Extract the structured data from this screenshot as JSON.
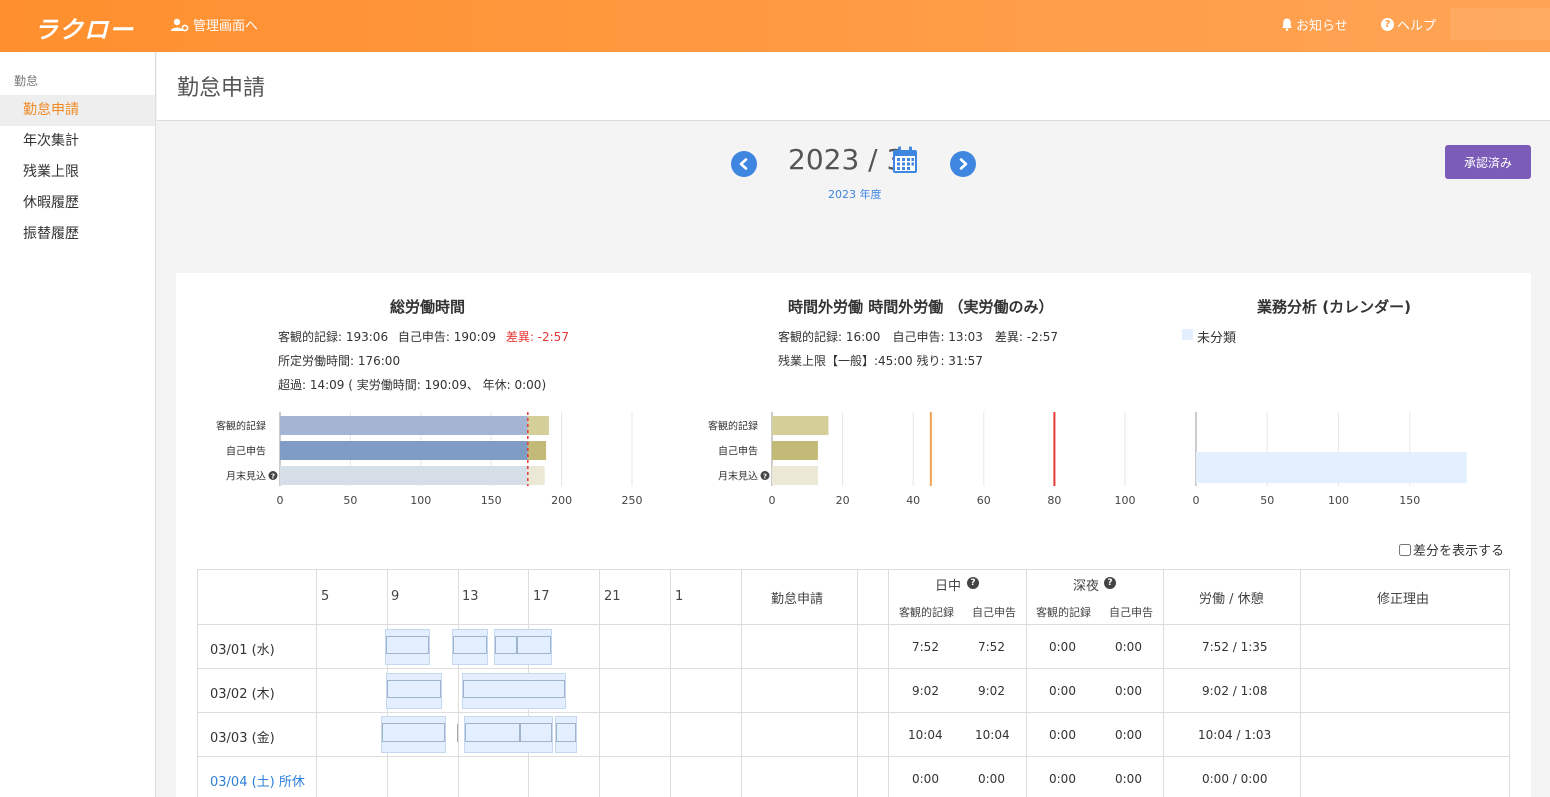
{
  "header": {
    "logo": "ラクロー",
    "admin_link": "管理画面へ",
    "notice": "お知らせ",
    "help": "ヘルプ"
  },
  "sidebar": {
    "section": "勤怠",
    "items": [
      {
        "label": "勤怠申請",
        "active": true
      },
      {
        "label": "年次集計"
      },
      {
        "label": "残業上限"
      },
      {
        "label": "休暇履歴"
      },
      {
        "label": "振替履歴"
      }
    ]
  },
  "page": {
    "title": "勤怠申請",
    "month_label": "2023 / 3",
    "fiscal_year": "2023 年度",
    "approved_button": "承認済み"
  },
  "summary": {
    "total": {
      "title": "総労働時間",
      "line1_objective": "客観的記録: 193:06",
      "line1_self": "自己申告: 190:09",
      "line1_diff": "差異: -2:57",
      "line2": "所定労働時間: 176:00",
      "line3": "超過: 14:09 ( 実労働時間: 190:09、 年休: 0:00)"
    },
    "overtime": {
      "title": "時間外労働 時間外労働 （実労働のみ）",
      "line1": "客観的記録: 16:00　自己申告: 13:03　差異: -2:57",
      "line2": "残業上限【一般】:45:00  残り: 31:57"
    },
    "analysis": {
      "title": "業務分析 (カレンダー)",
      "legend": "未分類"
    }
  },
  "chart_data": [
    {
      "type": "bar",
      "orientation": "horizontal",
      "stacked": true,
      "categories": [
        "客観的記録",
        "自己申告",
        "月末見込"
      ],
      "series": [
        {
          "values": [
            176,
            176,
            176
          ],
          "colors": [
            "#a4b5d3",
            "#7f9cc4",
            "#d6dee8"
          ]
        },
        {
          "values": [
            15,
            13,
            12
          ],
          "colors": [
            "#d4cf98",
            "#c2ba76",
            "#ece8d6"
          ]
        }
      ],
      "xlim": [
        0,
        250
      ],
      "xticks": [
        0,
        50,
        100,
        150,
        200,
        250
      ],
      "reference_lines": [
        {
          "x": 176,
          "color": "#e53935",
          "style": "dashed"
        }
      ]
    },
    {
      "type": "bar",
      "orientation": "horizontal",
      "categories": [
        "客観的記録",
        "自己申告",
        "月末見込"
      ],
      "values": [
        16,
        13,
        13
      ],
      "colors": [
        "#d4cf98",
        "#c2ba76",
        "#ece8d6"
      ],
      "xlim": [
        0,
        100
      ],
      "xticks": [
        0,
        20,
        40,
        60,
        80,
        100
      ],
      "reference_lines": [
        {
          "x": 45,
          "color": "#f0a050"
        },
        {
          "x": 80,
          "color": "#e53935"
        }
      ]
    },
    {
      "type": "bar",
      "orientation": "horizontal",
      "categories": [
        "未分類"
      ],
      "values": [
        190
      ],
      "colors": [
        "#e3efff"
      ],
      "xlim": [
        0,
        200
      ],
      "xticks": [
        0,
        50,
        100,
        150
      ]
    }
  ],
  "icons": {
    "admin": "user-cog-icon",
    "notice": "bell-icon",
    "help": "question-circle-icon",
    "prev": "chevron-left-icon",
    "next": "chevron-right-icon",
    "calendar": "calendar-icon"
  },
  "table": {
    "diff_toggle": "差分を表示する",
    "hours": [
      "5",
      "9",
      "13",
      "17",
      "21",
      "1"
    ],
    "headers": {
      "application": "勤怠申請",
      "day": "日中",
      "night": "深夜",
      "work_break": "労働 / 休憩",
      "reason": "修正理由",
      "objective": "客観的記録",
      "self": "自己申告"
    },
    "rows": [
      {
        "date": "03/01 (水)",
        "day_obj": "7:52",
        "day_self": "7:52",
        "night_obj": "0:00",
        "night_self": "0:00",
        "work_break": "7:52 / 1:35",
        "holiday": false
      },
      {
        "date": "03/02 (木)",
        "day_obj": "9:02",
        "day_self": "9:02",
        "night_obj": "0:00",
        "night_self": "0:00",
        "work_break": "9:02 / 1:08",
        "holiday": false
      },
      {
        "date": "03/03 (金)",
        "day_obj": "10:04",
        "day_self": "10:04",
        "night_obj": "0:00",
        "night_self": "0:00",
        "work_break": "10:04 / 1:03",
        "holiday": false
      },
      {
        "date": "03/04 (土)   所休",
        "day_obj": "0:00",
        "day_self": "0:00",
        "night_obj": "0:00",
        "night_self": "0:00",
        "work_break": "0:00 / 0:00",
        "holiday": true
      }
    ]
  }
}
